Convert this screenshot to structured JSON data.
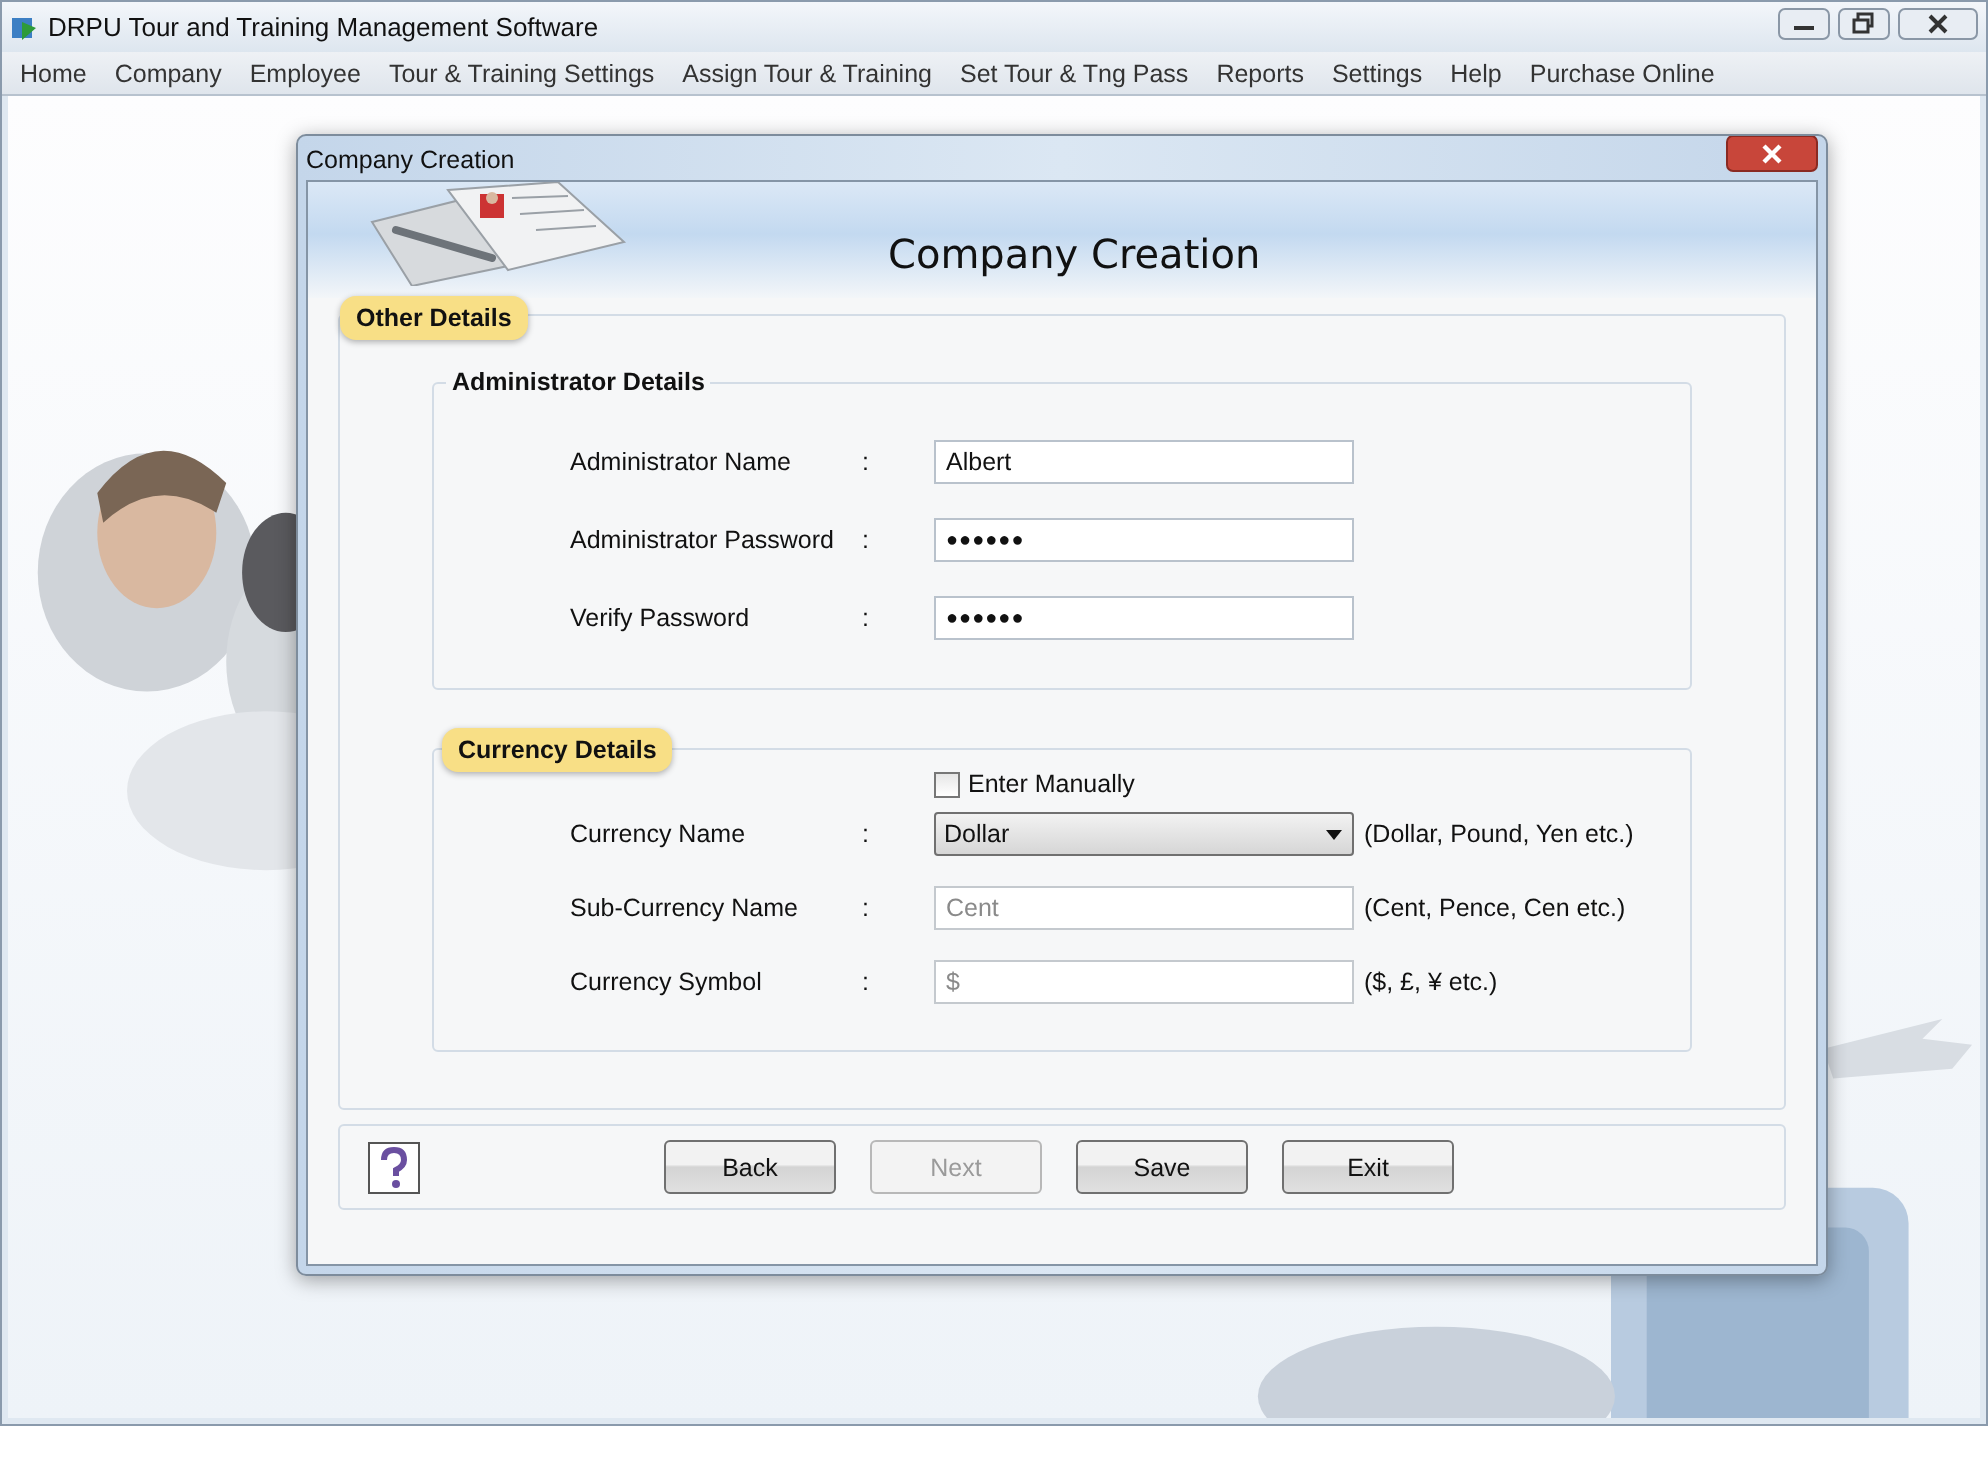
{
  "window": {
    "title": "DRPU Tour and Training Management Software"
  },
  "menu": [
    "Home",
    "Company",
    "Employee",
    "Tour & Training Settings",
    "Assign Tour & Training",
    "Set Tour & Tng Pass",
    "Reports",
    "Settings",
    "Help",
    "Purchase Online"
  ],
  "dialog": {
    "title": "Company Creation",
    "heading": "Company Creation",
    "other_details": {
      "label": "Other Details",
      "administrator": {
        "label": "Administrator Details",
        "fields": [
          {
            "label": "Administrator Name",
            "separator": ":",
            "kind": "text",
            "value": "Albert",
            "disabled": false
          },
          {
            "label": "Administrator Password",
            "separator": ":",
            "kind": "password",
            "value": "●●●●●●",
            "disabled": false
          },
          {
            "label": "Verify Password",
            "separator": ":",
            "kind": "password",
            "value": "●●●●●●",
            "disabled": false
          }
        ]
      },
      "currency": {
        "label": "Currency Details",
        "enter_manually": {
          "label": "Enter Manually",
          "checked": false
        },
        "fields": [
          {
            "label": "Currency Name",
            "separator": ":",
            "kind": "dropdown",
            "value": "Dollar",
            "disabled": false,
            "hint": "(Dollar, Pound, Yen etc.)"
          },
          {
            "label": "Sub-Currency Name",
            "separator": ":",
            "kind": "text",
            "value": "Cent",
            "disabled": true,
            "hint": "(Cent, Pence, Cen etc.)"
          },
          {
            "label": "Currency Symbol",
            "separator": ":",
            "kind": "text",
            "value": "$",
            "disabled": true,
            "hint": "($, £, ¥ etc.)"
          }
        ]
      }
    },
    "buttons": [
      {
        "label": "Back",
        "disabled": false
      },
      {
        "label": "Next",
        "disabled": true
      },
      {
        "label": "Save",
        "disabled": false
      },
      {
        "label": "Exit",
        "disabled": false
      }
    ]
  }
}
